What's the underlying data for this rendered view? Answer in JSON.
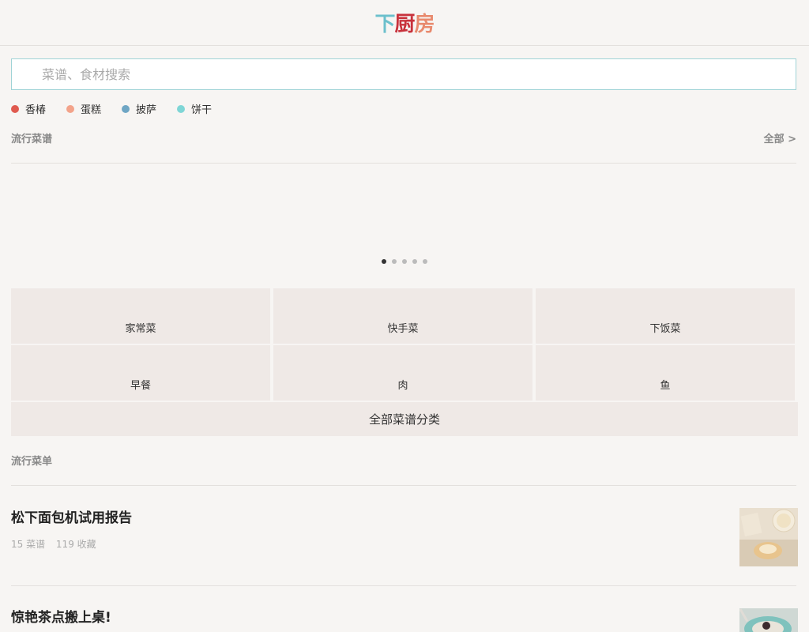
{
  "header": {
    "logo": [
      "下",
      "厨",
      "房"
    ]
  },
  "search": {
    "placeholder": "菜谱、食材搜索",
    "value": ""
  },
  "hot_tags": [
    {
      "label": "香椿",
      "color": "#e05a4f"
    },
    {
      "label": "蛋糕",
      "color": "#f3a38a"
    },
    {
      "label": "披萨",
      "color": "#6fa6c4"
    },
    {
      "label": "饼干",
      "color": "#7fd6d6"
    }
  ],
  "popular_recipes": {
    "title": "流行菜谱",
    "more_label": "全部 >",
    "carousel_pages": 5,
    "active_page": 1
  },
  "categories": {
    "items": [
      "家常菜",
      "快手菜",
      "下饭菜",
      "早餐",
      "肉",
      "鱼"
    ],
    "all_label": "全部菜谱分类"
  },
  "popular_lists": {
    "title": "流行菜单",
    "items": [
      {
        "title": "松下面包机试用报告",
        "recipes": "15 菜谱",
        "favorites": "119 收藏"
      },
      {
        "title": "惊艳茶点搬上桌!",
        "recipes": "",
        "favorites": ""
      }
    ]
  },
  "colors": {
    "accent_border": "#9fd3d6",
    "tile_bg": "#efe9e6",
    "page_bg": "#f7f5f3"
  }
}
